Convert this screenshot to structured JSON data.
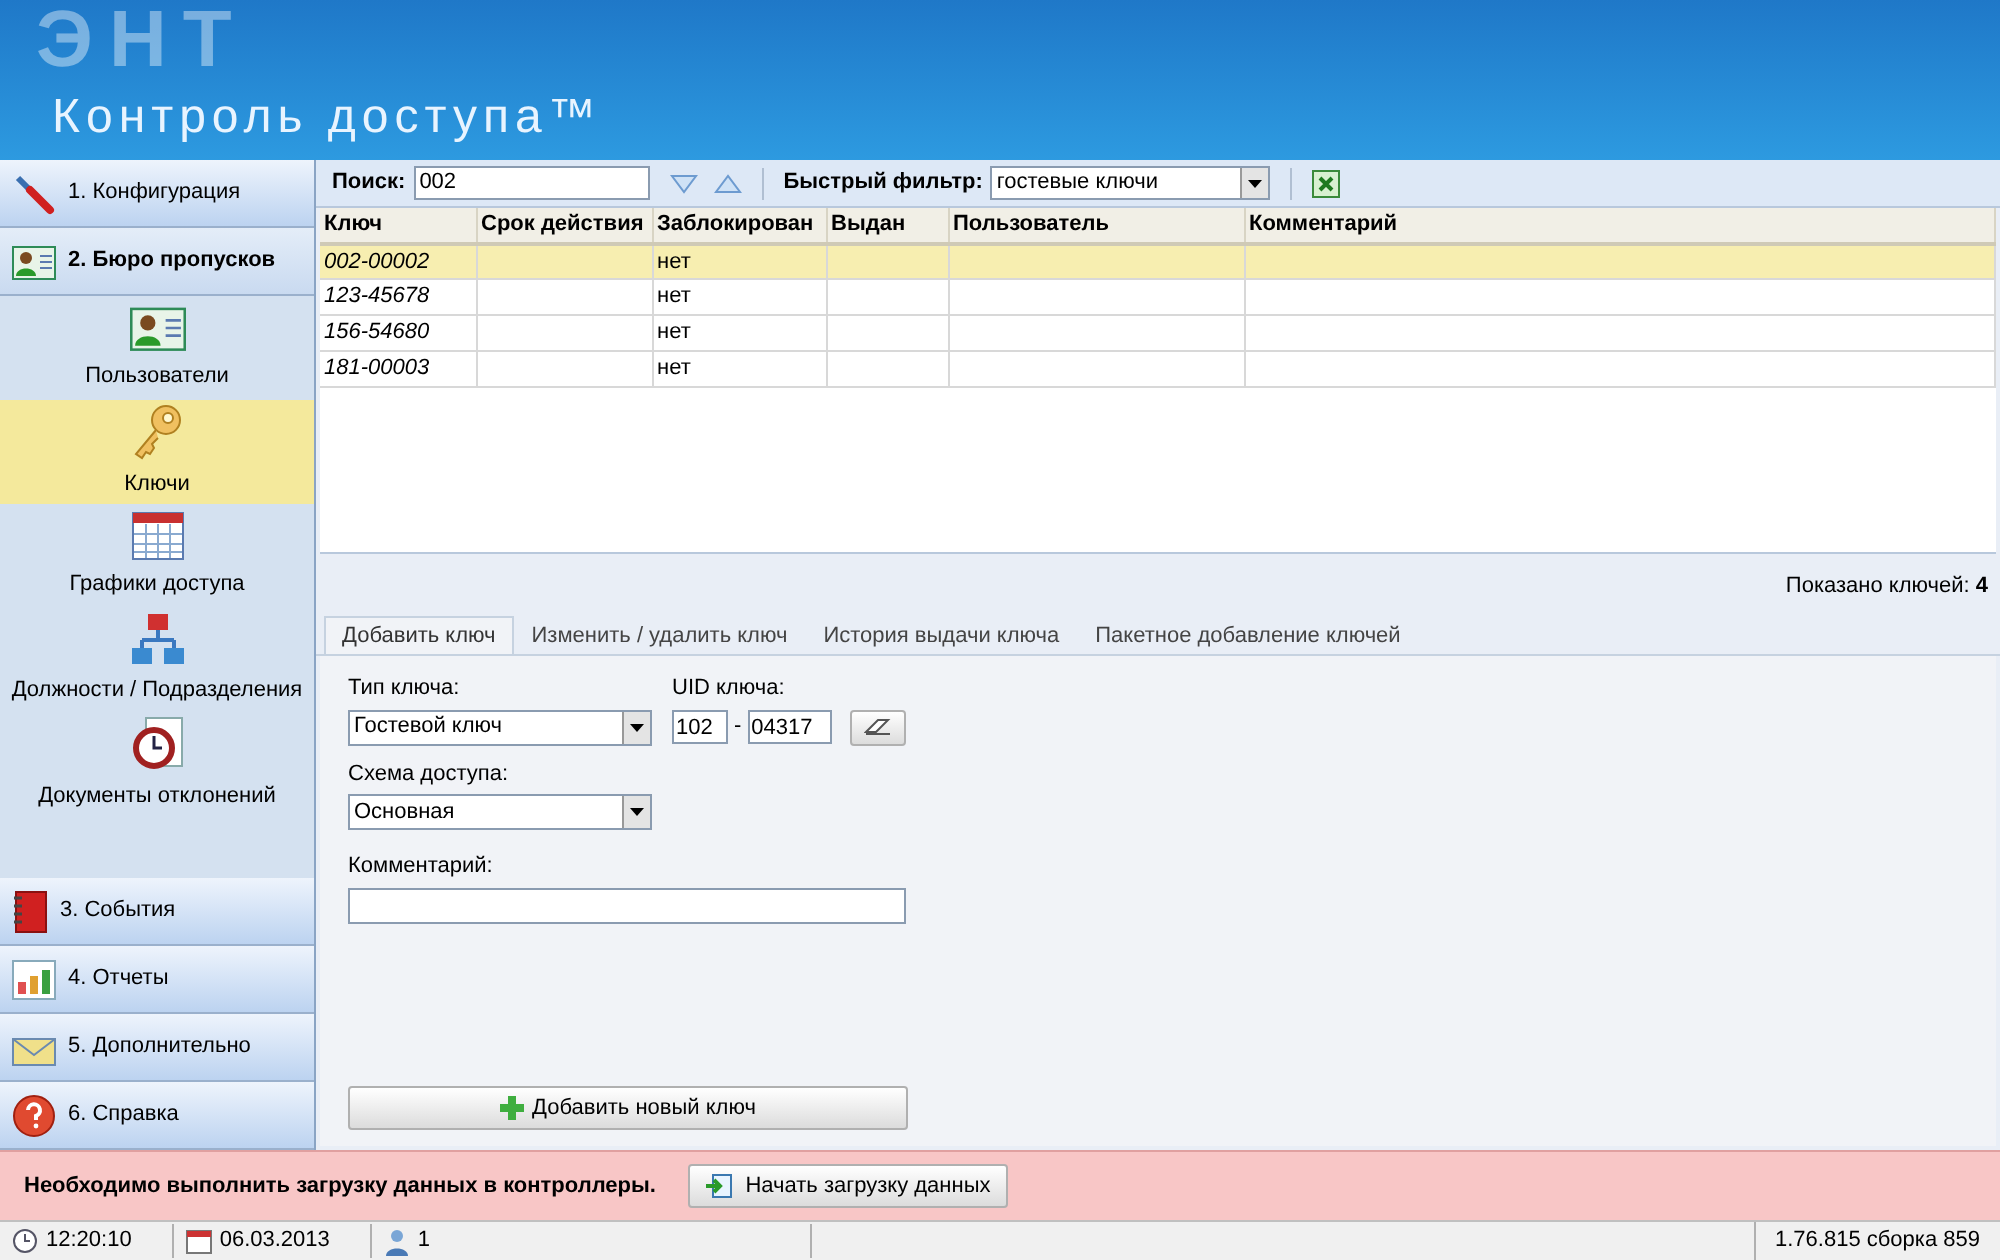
{
  "header": {
    "logo_mark": "ЭНТ",
    "title": "Контроль доступа™"
  },
  "sidebar": {
    "sections": [
      {
        "label": "1. Конфигурация",
        "expanded": false
      },
      {
        "label": "2. Бюро пропусков",
        "expanded": true,
        "items": [
          {
            "label": "Пользователи",
            "selected": false
          },
          {
            "label": "Ключи",
            "selected": true
          },
          {
            "label": "Графики доступа",
            "selected": false
          },
          {
            "label": "Должности / Подразделения",
            "selected": false
          },
          {
            "label": "Документы отклонений",
            "selected": false
          }
        ]
      },
      {
        "label": "3. События",
        "expanded": false
      },
      {
        "label": "4. Отчеты",
        "expanded": false
      },
      {
        "label": "5. Дополнительно",
        "expanded": false
      },
      {
        "label": "6. Справка",
        "expanded": false
      }
    ]
  },
  "toolbar": {
    "search_label": "Поиск:",
    "search_value": "002",
    "filter_label": "Быстрый фильтр:",
    "filter_value": "гостевые ключи"
  },
  "table": {
    "columns": [
      "Ключ",
      "Срок действия",
      "Заблокирован",
      "Выдан",
      "Пользователь",
      "Комментарий"
    ],
    "rows": [
      {
        "cells": [
          "002-00002",
          "",
          "нет",
          "",
          "",
          ""
        ],
        "selected": true
      },
      {
        "cells": [
          "123-45678",
          "",
          "нет",
          "",
          "",
          ""
        ],
        "selected": false
      },
      {
        "cells": [
          "156-54680",
          "",
          "нет",
          "",
          "",
          ""
        ],
        "selected": false
      },
      {
        "cells": [
          "181-00003",
          "",
          "нет",
          "",
          "",
          ""
        ],
        "selected": false
      }
    ]
  },
  "shown_count": "Показано ключей: **4**",
  "tabs": [
    {
      "label": "Добавить ключ",
      "selected": true
    },
    {
      "label": "Изменить / удалить ключ",
      "selected": false
    },
    {
      "label": "История выдачи ключа",
      "selected": false
    },
    {
      "label": "Пакетное добавление ключей",
      "selected": false
    }
  ],
  "form": {
    "key_type_label": "Тип ключа:",
    "key_type_value": "Гостевой ключ",
    "uid_label": "UID ключа:",
    "uid_part1": "102",
    "uid_separator": "-",
    "uid_part2": "04317",
    "scheme_label": "Схема доступа:",
    "scheme_value": "Основная",
    "comment_label": "Комментарий:",
    "add_button": "Добавить новый ключ"
  },
  "alert": {
    "message": "Необходимо выполнить загрузку данных в контроллеры.",
    "button": "Начать загрузку данных"
  },
  "status_bar": {
    "time": "12:20:10",
    "date": "06.03.2013",
    "users": "1",
    "version": "1.76.815 сборка 859"
  }
}
